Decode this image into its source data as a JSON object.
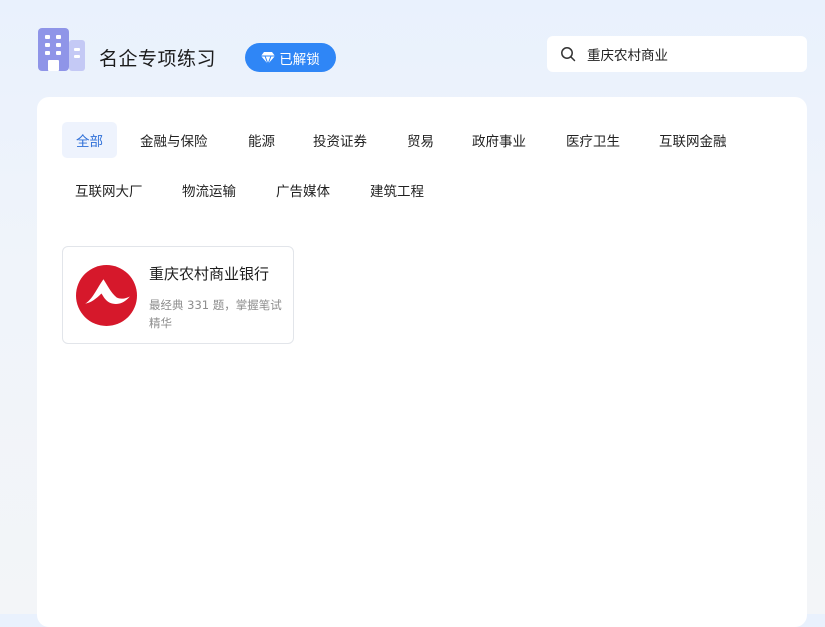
{
  "header": {
    "title": "名企专项练习",
    "badge_label": "已解锁",
    "search_value": "重庆农村商业"
  },
  "categories": [
    {
      "label": "全部",
      "active": true
    },
    {
      "label": "金融与保险"
    },
    {
      "label": "能源"
    },
    {
      "label": "投资证券"
    },
    {
      "label": "贸易"
    },
    {
      "label": "政府事业"
    },
    {
      "label": "医疗卫生"
    },
    {
      "label": "互联网金融"
    },
    {
      "label": "互联网大厂"
    },
    {
      "label": "物流运输"
    },
    {
      "label": "广告媒体"
    },
    {
      "label": "建筑工程"
    }
  ],
  "results": [
    {
      "name": "重庆农村商业银行",
      "description": "最经典 331 题，掌握笔试精华",
      "logo_color": "#d6182b"
    }
  ],
  "colors": {
    "accent": "#2f86f6",
    "active_tab_bg": "#eef3fd",
    "active_tab_text": "#2e6fd8"
  }
}
